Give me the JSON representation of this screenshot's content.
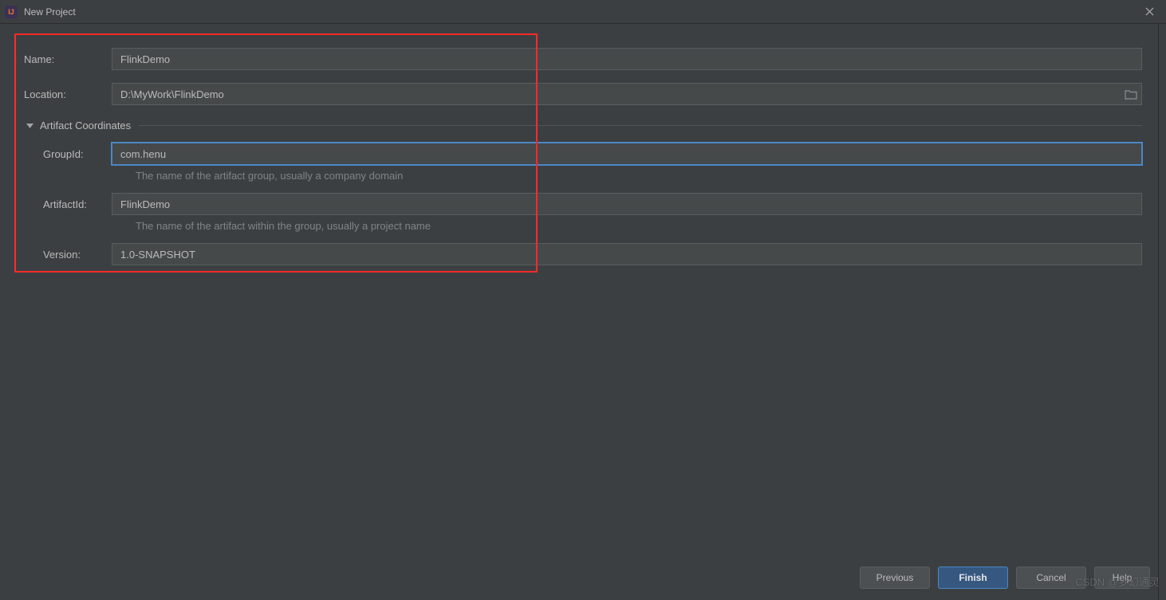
{
  "window": {
    "title": "New Project"
  },
  "fields": {
    "name": {
      "label": "Name:",
      "value": "FlinkDemo"
    },
    "location": {
      "label": "Location:",
      "value": "D:\\MyWork\\FlinkDemo"
    },
    "groupId": {
      "label": "GroupId:",
      "value": "com.henu",
      "hint": "The name of the artifact group, usually a company domain"
    },
    "artifactId": {
      "label": "ArtifactId:",
      "value": "FlinkDemo",
      "hint": "The name of the artifact within the group, usually a project name"
    },
    "version": {
      "label": "Version:",
      "value": "1.0-SNAPSHOT"
    }
  },
  "section": {
    "artifactCoordinates": "Artifact Coordinates"
  },
  "buttons": {
    "previous": "Previous",
    "finish": "Finish",
    "cancel": "Cancel",
    "help": "Help"
  },
  "watermark": "CSDN @梦幻通灵"
}
